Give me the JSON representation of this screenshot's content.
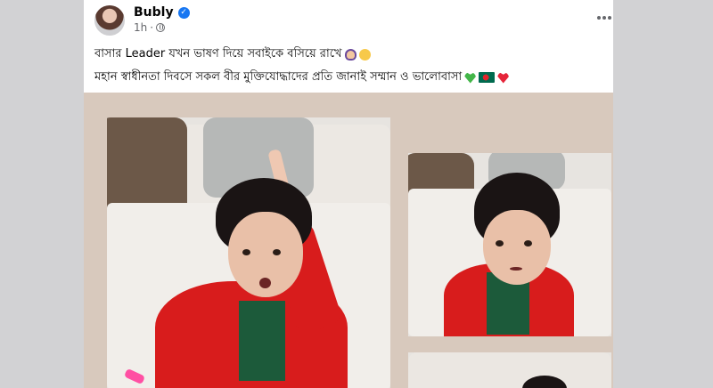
{
  "post": {
    "author": "Bubly",
    "time": "1h",
    "separator": "·",
    "caption_line1_text": "বাসার Leader যখন ভাষণ দিয়ে সবাইকে বসিয়ে রাখে",
    "caption_line2_text": "মহান স্বাধীনতা দিবসে সকল বীর মুক্তিযোদ্ধাদের প্রতি জানাই সম্মান ও ভালোবাসা",
    "icons": {
      "verified": "verified-badge-icon",
      "privacy": "globe-icon",
      "more": "more-options-icon"
    },
    "emojis_line1": [
      "person-raising-hand-emoji",
      "smiling-face-emoji"
    ],
    "emojis_line2": [
      "green-heart-emoji",
      "bangladesh-flag-emoji",
      "red-heart-emoji"
    ],
    "photos": [
      "main-photo",
      "right-photo",
      "bottom-photo"
    ]
  },
  "colors": {
    "page_bg": "#d2d2d4",
    "post_bg": "#ffffff",
    "media_bg": "#d8c9bd",
    "verified_blue": "#1877f2",
    "jacket_red": "#d81c1c"
  }
}
